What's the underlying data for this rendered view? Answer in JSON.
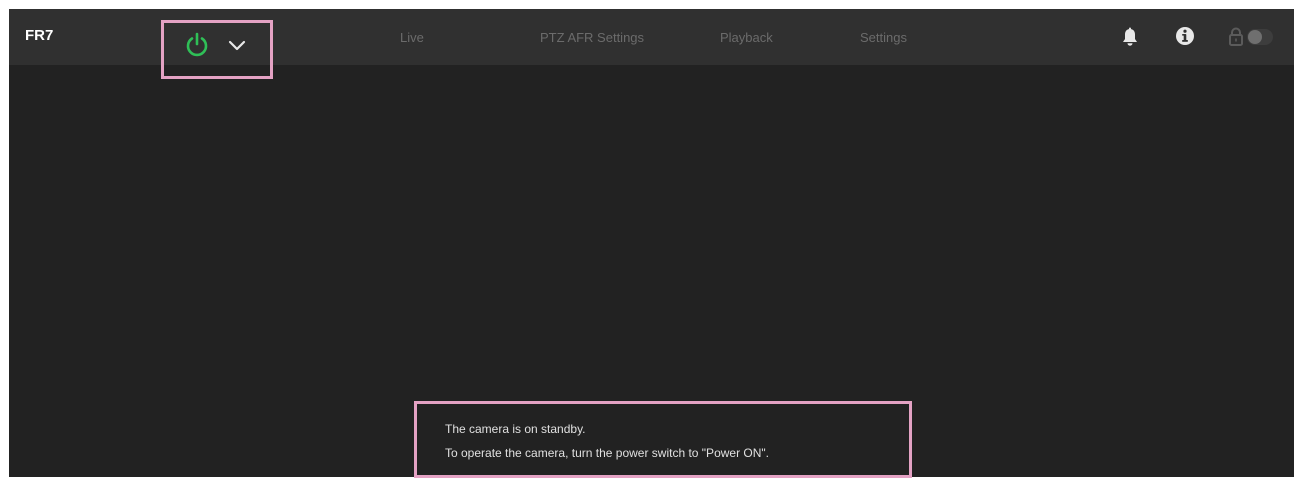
{
  "app": {
    "title": "FR7"
  },
  "power": {
    "icon": "power-icon",
    "menu_icon": "chevron-down-icon",
    "status_color": "#2fbf57"
  },
  "nav": {
    "items": [
      {
        "label": "Live"
      },
      {
        "label": "PTZ AFR Settings"
      },
      {
        "label": "Playback"
      },
      {
        "label": "Settings"
      }
    ]
  },
  "header_icons": {
    "notifications": "bell-icon",
    "info": "info-icon",
    "lock": "lock-icon",
    "lock_toggle_state": "off"
  },
  "message": {
    "line1": "The camera is on standby.",
    "line2": "To operate the camera, turn the power switch to \"Power ON\"."
  },
  "colors": {
    "background": "#222222",
    "header": "#303030",
    "highlight_border": "#e4a2c4",
    "inactive_nav": "#6b6b6b",
    "icon": "#e8e8e8"
  }
}
